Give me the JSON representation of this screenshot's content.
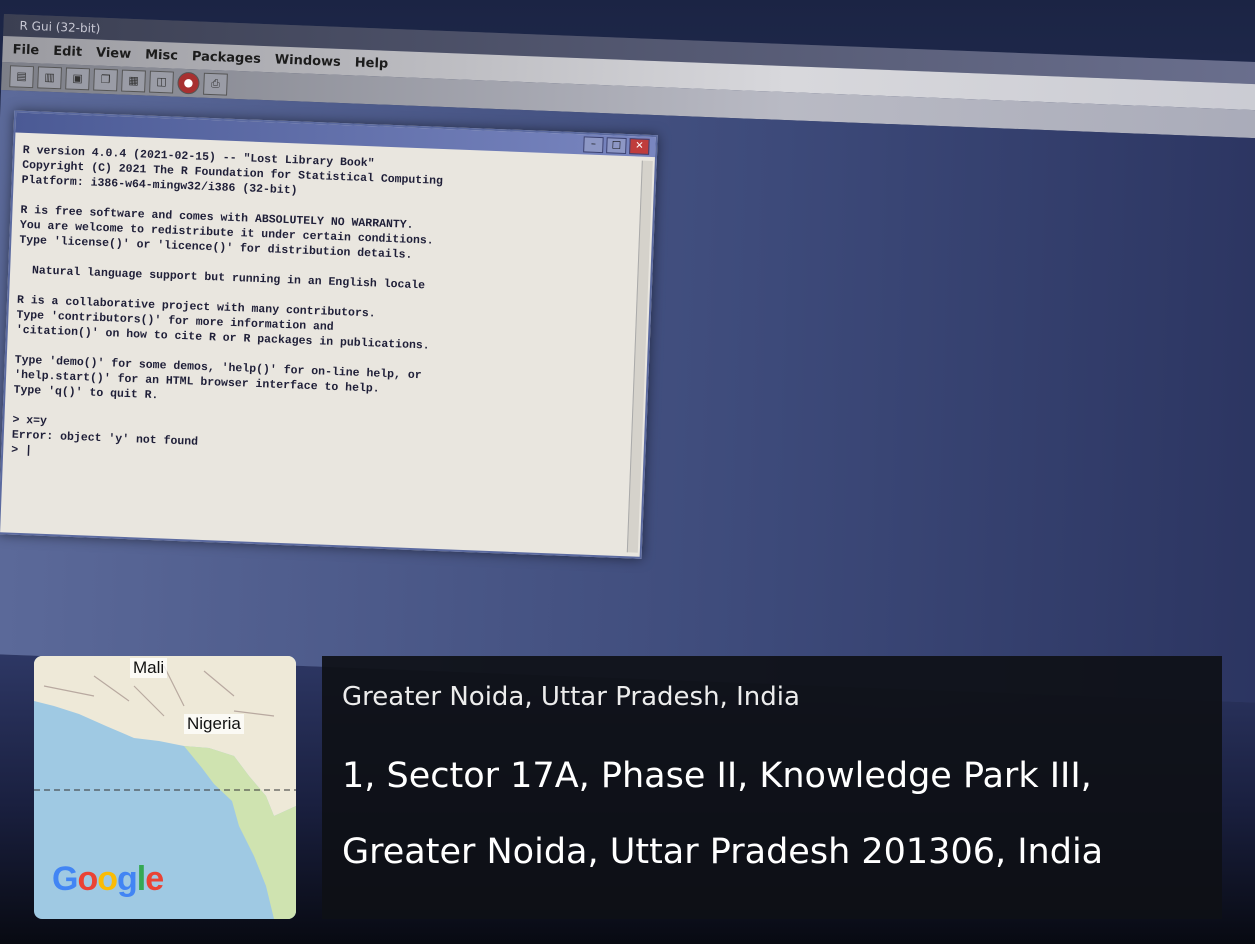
{
  "rgui": {
    "window_title": "R Gui (32-bit)",
    "menu": [
      "File",
      "Edit",
      "View",
      "Misc",
      "Packages",
      "Windows",
      "Help"
    ],
    "toolbar_icons": [
      "open-script-icon",
      "load-workspace-icon",
      "save-icon",
      "copy-icon",
      "paste-icon",
      "copy-paste-icon",
      "stop-icon",
      "print-icon"
    ],
    "console_lines": [
      "R version 4.0.4 (2021-02-15) -- \"Lost Library Book\"",
      "Copyright (C) 2021 The R Foundation for Statistical Computing",
      "Platform: i386-w64-mingw32/i386 (32-bit)",
      "",
      "R is free software and comes with ABSOLUTELY NO WARRANTY.",
      "You are welcome to redistribute it under certain conditions.",
      "Type 'license()' or 'licence()' for distribution details.",
      "",
      "  Natural language support but running in an English locale",
      "",
      "R is a collaborative project with many contributors.",
      "Type 'contributors()' for more information and",
      "'citation()' on how to cite R or R packages in publications.",
      "",
      "Type 'demo()' for some demos, 'help()' for on-line help, or",
      "'help.start()' for an HTML browser interface to help.",
      "Type 'q()' to quit R.",
      "",
      "> x=y",
      "Error: object 'y' not found",
      "> |"
    ]
  },
  "geo_overlay": {
    "map_labels": {
      "mali": "Mali",
      "nigeria": "Nigeria"
    },
    "map_logo": "Google",
    "place_name": "Greater Noida, Uttar Pradesh, India",
    "address_line_1": "1, Sector 17A, Phase II, Knowledge Park III,",
    "address_line_2": "Greater Noida, Uttar Pradesh 201306, India"
  },
  "colors": {
    "google_blue": "#4285F4",
    "google_red": "#EA4335",
    "google_yellow": "#FBBC05",
    "google_green": "#34A853"
  }
}
